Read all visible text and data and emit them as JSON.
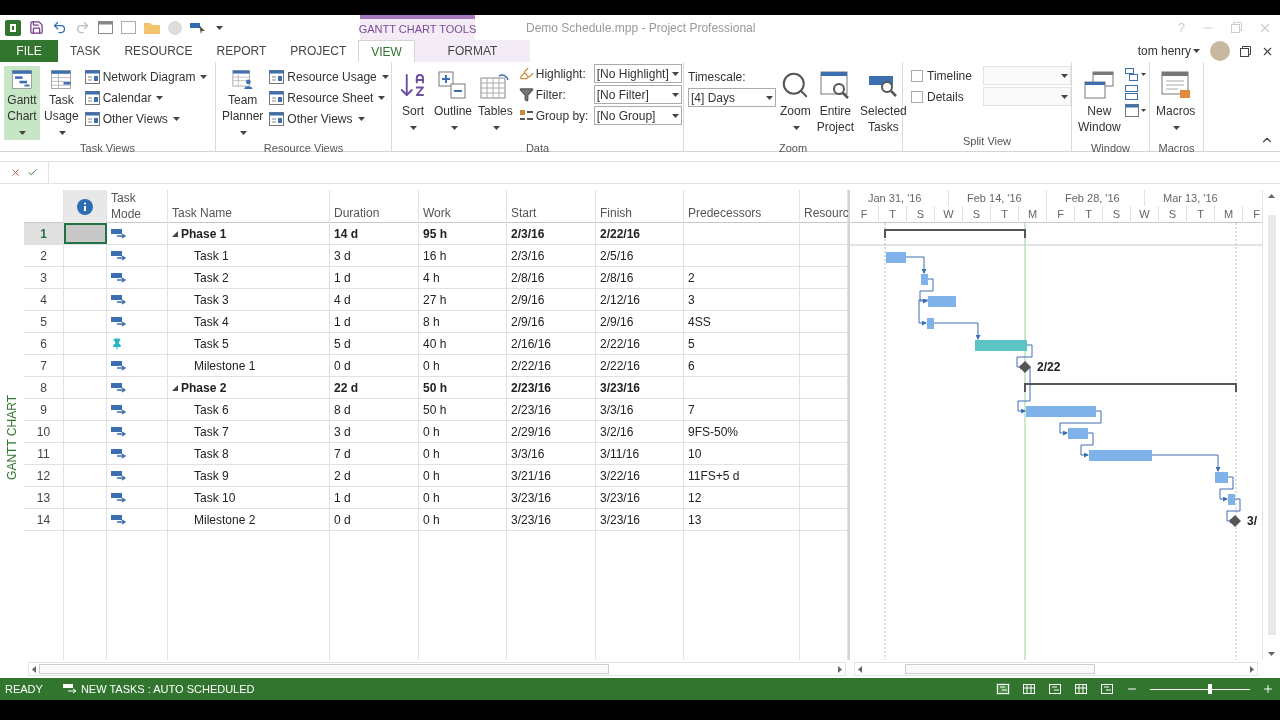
{
  "title_bar": {
    "contextual_group": "GANTT CHART TOOLS",
    "title": "Demo Schedule.mpp - Project Professional",
    "help": "?"
  },
  "tabs": [
    {
      "label": "FILE",
      "kind": "file",
      "selected": false
    },
    {
      "label": "TASK",
      "kind": "normal",
      "selected": false
    },
    {
      "label": "RESOURCE",
      "kind": "normal",
      "selected": false
    },
    {
      "label": "REPORT",
      "kind": "normal",
      "selected": false
    },
    {
      "label": "PROJECT",
      "kind": "normal",
      "selected": false
    },
    {
      "label": "VIEW",
      "kind": "normal",
      "selected": true
    },
    {
      "label": "FORMAT",
      "kind": "contextual",
      "selected": false
    }
  ],
  "user": {
    "name": "tom henry"
  },
  "ribbon": {
    "groups": [
      {
        "label": "Task Views",
        "items": [
          {
            "kind": "large",
            "label": "Gantt Chart",
            "dropdown": true,
            "selected": true
          },
          {
            "kind": "large",
            "label": "Task Usage",
            "dropdown": true,
            "selected": false
          },
          {
            "kind": "small",
            "label": "Network Diagram",
            "dropdown": true,
            "selected": false
          },
          {
            "kind": "small",
            "label": "Calendar",
            "dropdown": true,
            "selected": false
          },
          {
            "kind": "small",
            "label": "Other Views",
            "dropdown": true,
            "selected": false
          }
        ]
      },
      {
        "label": "Resource Views",
        "items": [
          {
            "kind": "large",
            "label": "Team Planner",
            "dropdown": true,
            "selected": false
          },
          {
            "kind": "small",
            "label": "Resource Usage",
            "dropdown": true,
            "selected": false
          },
          {
            "kind": "small",
            "label": "Resource Sheet",
            "dropdown": true,
            "selected": false
          },
          {
            "kind": "small",
            "label": "Other Views",
            "dropdown": true,
            "selected": false
          }
        ]
      },
      {
        "label": "Data",
        "items": [
          {
            "kind": "large",
            "label": "Sort",
            "dropdown": true,
            "selected": false
          },
          {
            "kind": "large",
            "label": "Outline",
            "dropdown": true,
            "selected": false
          },
          {
            "kind": "large",
            "label": "Tables",
            "dropdown": true,
            "selected": false
          },
          {
            "kind": "combo",
            "label": "Highlight:",
            "value": "[No Highlight]"
          },
          {
            "kind": "combo",
            "label": "Filter:",
            "value": "[No Filter]"
          },
          {
            "kind": "combo",
            "label": "Group by:",
            "value": "[No Group]"
          }
        ]
      },
      {
        "label": "Zoom",
        "items": [
          {
            "kind": "combo",
            "label": "Timescale:",
            "value": "[4] Days"
          },
          {
            "kind": "large",
            "label": "Zoom",
            "dropdown": true,
            "selected": false
          },
          {
            "kind": "large",
            "label": "Entire Project",
            "dropdown": false,
            "selected": false
          },
          {
            "kind": "large",
            "label": "Selected Tasks",
            "dropdown": false,
            "selected": false
          }
        ]
      },
      {
        "label": "Split View",
        "items": [
          {
            "kind": "check",
            "label": "Timeline",
            "checked": false
          },
          {
            "kind": "check",
            "label": "Details",
            "checked": false
          }
        ]
      },
      {
        "label": "Window",
        "items": [
          {
            "kind": "large",
            "label": "New Window",
            "dropdown": false,
            "selected": false
          }
        ]
      },
      {
        "label": "Macros",
        "items": [
          {
            "kind": "large",
            "label": "Macros",
            "dropdown": true,
            "selected": false
          }
        ]
      }
    ]
  },
  "side_label": "GANTT CHART",
  "table": {
    "columns": [
      "Task Mode",
      "Task Name",
      "Duration",
      "Work",
      "Start",
      "Finish",
      "Predecessors",
      "Resourc"
    ],
    "rows": [
      {
        "id": "1",
        "kind": "summary",
        "manual": false,
        "name": "Phase 1",
        "duration": "14 d",
        "work": "95 h",
        "start": "2/3/16",
        "finish": "2/22/16",
        "selected": true,
        "expanded": true,
        "children": [
          {
            "id": "2",
            "kind": "task",
            "manual": false,
            "name": "Task 1",
            "duration": "3 d",
            "work": "16 h",
            "start": "2/3/16",
            "finish": "2/5/16",
            "selected": false
          },
          {
            "id": "3",
            "kind": "task",
            "manual": false,
            "name": "Task 2",
            "duration": "1 d",
            "work": "4 h",
            "start": "2/8/16",
            "finish": "2/8/16",
            "predecessors": "2",
            "selected": false
          },
          {
            "id": "4",
            "kind": "task",
            "manual": false,
            "name": "Task 3",
            "duration": "4 d",
            "work": "27 h",
            "start": "2/9/16",
            "finish": "2/12/16",
            "predecessors": "3",
            "selected": false
          },
          {
            "id": "5",
            "kind": "task",
            "manual": false,
            "name": "Task 4",
            "duration": "1 d",
            "work": "8 h",
            "start": "2/9/16",
            "finish": "2/9/16",
            "predecessors": "4SS",
            "selected": false
          },
          {
            "id": "6",
            "kind": "task",
            "manual": true,
            "name": "Task 5",
            "duration": "5 d",
            "work": "40 h",
            "start": "2/16/16",
            "finish": "2/22/16",
            "predecessors": "5",
            "selected": false
          },
          {
            "id": "7",
            "kind": "milestone",
            "manual": false,
            "name": "Milestone 1",
            "duration": "0 d",
            "work": "0 h",
            "start": "2/22/16",
            "finish": "2/22/16",
            "predecessors": "6",
            "bar_label": "2/22",
            "selected": false
          }
        ]
      },
      {
        "id": "8",
        "kind": "summary",
        "manual": false,
        "name": "Phase 2",
        "duration": "22 d",
        "work": "50 h",
        "start": "2/23/16",
        "finish": "3/23/16",
        "selected": false,
        "expanded": true,
        "children": [
          {
            "id": "9",
            "kind": "task",
            "manual": false,
            "name": "Task 6",
            "duration": "8 d",
            "work": "50 h",
            "start": "2/23/16",
            "finish": "3/3/16",
            "predecessors": "7",
            "selected": false
          },
          {
            "id": "10",
            "kind": "task",
            "manual": false,
            "name": "Task 7",
            "duration": "3 d",
            "work": "0 h",
            "start": "2/29/16",
            "finish": "3/2/16",
            "predecessors": "9FS-50%",
            "selected": false
          },
          {
            "id": "11",
            "kind": "task",
            "manual": false,
            "name": "Task 8",
            "duration": "7 d",
            "work": "0 h",
            "start": "3/3/16",
            "finish": "3/11/16",
            "predecessors": "10",
            "selected": false
          },
          {
            "id": "12",
            "kind": "task",
            "manual": false,
            "name": "Task 9",
            "duration": "2 d",
            "work": "0 h",
            "start": "3/21/16",
            "finish": "3/22/16",
            "predecessors": "11FS+5 d",
            "selected": false
          },
          {
            "id": "13",
            "kind": "task",
            "manual": false,
            "name": "Task 10",
            "duration": "1 d",
            "work": "0 h",
            "start": "3/23/16",
            "finish": "3/23/16",
            "predecessors": "12",
            "selected": false
          },
          {
            "id": "14",
            "kind": "milestone",
            "manual": false,
            "name": "Milestone 2",
            "duration": "0 d",
            "work": "0 h",
            "start": "3/23/16",
            "finish": "3/23/16",
            "predecessors": "13",
            "bar_label": "3/",
            "selected": false
          }
        ]
      }
    ]
  },
  "gantt": {
    "timescale_major": [
      "Jan 31, '16",
      "Feb 14, '16",
      "Feb 28, '16",
      "Mar 13, '16"
    ],
    "timescale_minor": [
      "F",
      "T",
      "S",
      "W",
      "S",
      "T",
      "M",
      "F",
      "T",
      "S",
      "W",
      "S",
      "T",
      "M",
      "F"
    ]
  },
  "status_bar": {
    "mode": "READY",
    "new_tasks": "NEW TASKS : AUTO SCHEDULED",
    "zoom": {
      "level": 0.6
    }
  }
}
